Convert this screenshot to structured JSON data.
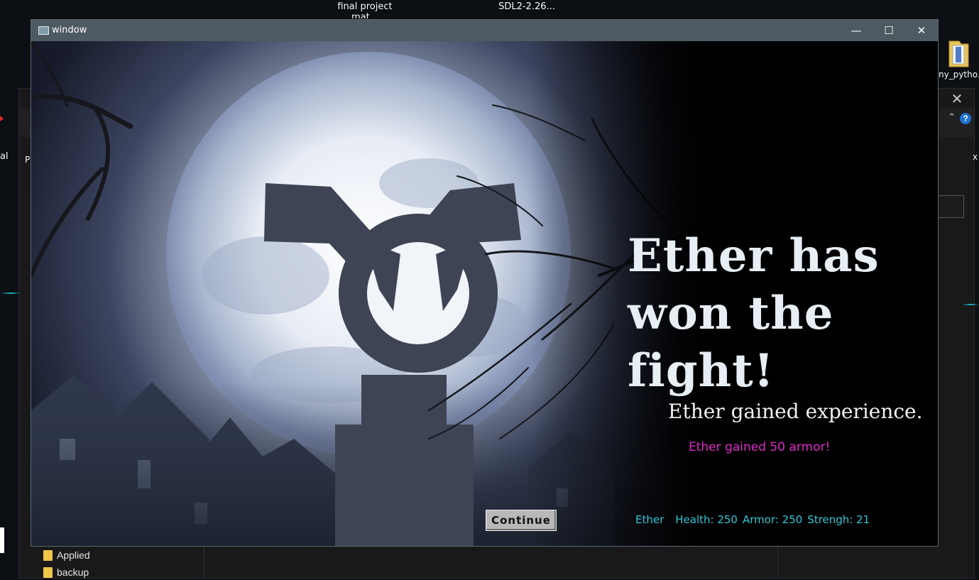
{
  "desktop": {
    "top_icons": [
      {
        "label": "final project\nmat..."
      },
      {
        "label": "SDL2-2.26..."
      }
    ],
    "right_icon_label": "ny_pytho...",
    "left_edge_labels": [
      "Pi",
      "al"
    ],
    "right_edge_label": "x"
  },
  "background_window": {
    "close_glyph": "✕",
    "up_glyph": "⌃",
    "help_glyph": "?",
    "folders": [
      "Applied",
      "backup"
    ]
  },
  "window": {
    "title": "window",
    "controls": {
      "minimize": "—",
      "maximize": "☐",
      "close": "✕"
    }
  },
  "game": {
    "headline": "Ether has won the fight!",
    "experience_message": "Ether gained experience.",
    "reward_message": "Ether gained 50 armor!",
    "continue_label": "Continue",
    "stats": {
      "name": "Ether",
      "health": "Health: 250",
      "armor": "Armor: 250",
      "strength": "Strengh: 21"
    },
    "colors": {
      "headline": "#e7eef4",
      "reward": "#df29c9",
      "stats": "#2fc6d6"
    }
  }
}
